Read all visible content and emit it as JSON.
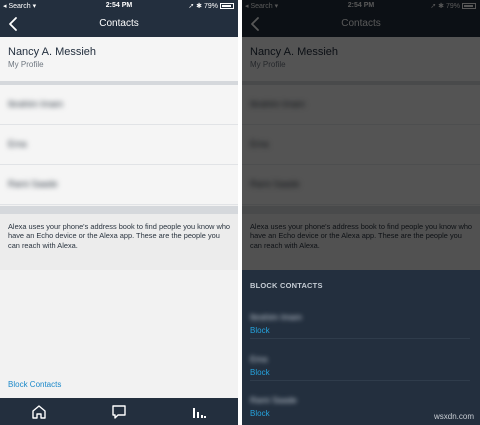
{
  "status": {
    "carrier": "Search",
    "time": "2:54 PM",
    "battery": "79%"
  },
  "nav": {
    "title": "Contacts"
  },
  "profile": {
    "name": "Nancy A. Messieh",
    "subtitle": "My Profile"
  },
  "contacts": [
    "Ibrahim Imam",
    "Ema",
    "Rami Saade"
  ],
  "info_text": "Alexa uses your phone's address book to find people you know who have an Echo device or the Alexa app. These are the people you can reach with Alexa.",
  "block_contacts_link": "Block Contacts",
  "tabs": [
    "home-icon",
    "chat-icon",
    "contacts-icon"
  ],
  "block_section": {
    "heading": "BLOCK CONTACTS",
    "items": [
      {
        "name": "Ibrahim Imam",
        "action": "Block"
      },
      {
        "name": "Ema",
        "action": "Block"
      },
      {
        "name": "Rami Saade",
        "action": "Block"
      }
    ]
  },
  "watermark": "wsxdn.com"
}
